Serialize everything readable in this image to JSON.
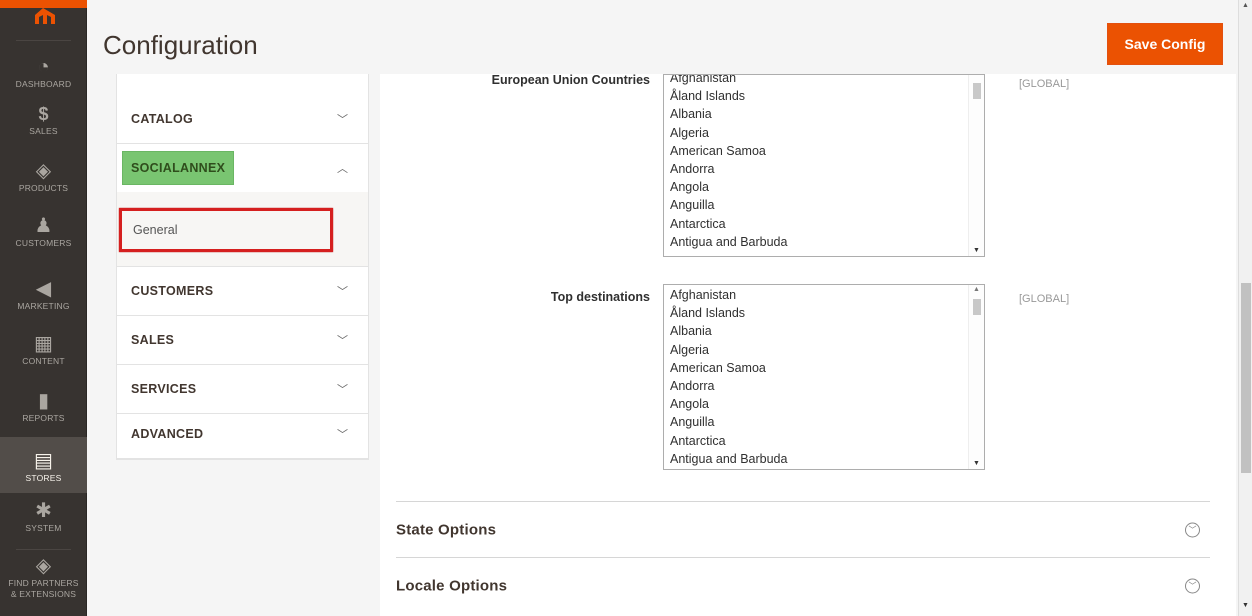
{
  "nav": {
    "items": [
      {
        "label": "DASHBOARD",
        "icon": "gauge-icon",
        "glyph": "◔"
      },
      {
        "label": "SALES",
        "icon": "dollar-icon",
        "glyph": "$"
      },
      {
        "label": "PRODUCTS",
        "icon": "cube-icon",
        "glyph": "◈"
      },
      {
        "label": "CUSTOMERS",
        "icon": "person-icon",
        "glyph": "♟"
      },
      {
        "label": "MARKETING",
        "icon": "megaphone-icon",
        "glyph": "◀"
      },
      {
        "label": "CONTENT",
        "icon": "layout-icon",
        "glyph": "▦"
      },
      {
        "label": "REPORTS",
        "icon": "bar-chart-icon",
        "glyph": "▮"
      },
      {
        "label": "STORES",
        "icon": "storefront-icon",
        "glyph": "▤"
      },
      {
        "label": "SYSTEM",
        "icon": "gear-icon",
        "glyph": "✱"
      },
      {
        "label": "FIND PARTNERS & EXTENSIONS",
        "label_line1": "FIND PARTNERS",
        "label_line2": "& EXTENSIONS",
        "icon": "box-icon",
        "glyph": "◈"
      }
    ]
  },
  "header": {
    "title": "Configuration",
    "save_label": "Save Config",
    "accent_color": "#eb5202"
  },
  "tabs": {
    "catalog": "CATALOG",
    "socialannex": "SOCIALANNEX",
    "general": "General",
    "customers": "CUSTOMERS",
    "sales": "SALES",
    "services": "SERVICES",
    "advanced": "ADVANCED"
  },
  "fields": {
    "eu_countries": {
      "label": "European Union Countries",
      "scope": "[GLOBAL]",
      "options": [
        "Afghanistan",
        "Åland Islands",
        "Albania",
        "Algeria",
        "American Samoa",
        "Andorra",
        "Angola",
        "Anguilla",
        "Antarctica",
        "Antigua and Barbuda"
      ]
    },
    "top_destinations": {
      "label": "Top destinations",
      "scope": "[GLOBAL]",
      "options": [
        "Afghanistan",
        "Åland Islands",
        "Albania",
        "Algeria",
        "American Samoa",
        "Andorra",
        "Angola",
        "Anguilla",
        "Antarctica",
        "Antigua and Barbuda"
      ]
    }
  },
  "sections": {
    "state_options": "State Options",
    "locale_options": "Locale Options"
  }
}
